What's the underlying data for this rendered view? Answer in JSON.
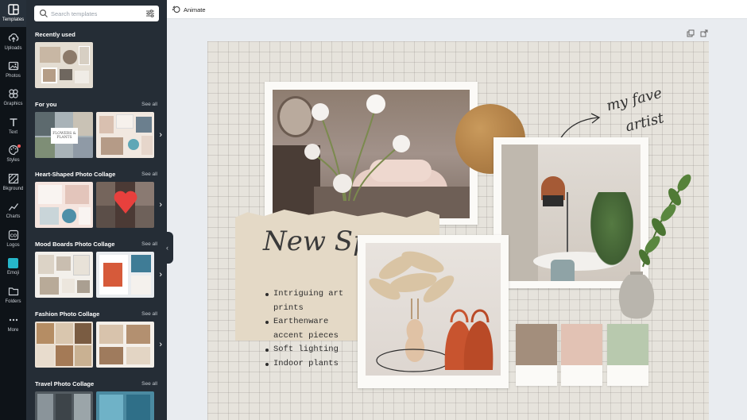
{
  "rail": {
    "items": [
      {
        "label": "Templates",
        "icon": "templates-icon"
      },
      {
        "label": "Uploads",
        "icon": "upload-icon"
      },
      {
        "label": "Photos",
        "icon": "photo-icon"
      },
      {
        "label": "Graphics",
        "icon": "graphics-icon"
      },
      {
        "label": "Text",
        "icon": "text-icon"
      },
      {
        "label": "Styles",
        "icon": "styles-icon"
      },
      {
        "label": "Bkground",
        "icon": "background-icon"
      },
      {
        "label": "Charts",
        "icon": "chart-icon"
      },
      {
        "label": "Logos",
        "icon": "logo-icon"
      },
      {
        "label": "Emoji",
        "icon": "emoji-icon"
      },
      {
        "label": "Folders",
        "icon": "folder-icon"
      },
      {
        "label": "More",
        "icon": "more-icon"
      }
    ]
  },
  "panel": {
    "search_placeholder": "Search templates",
    "recently_used": "Recently used",
    "see_all": "See all",
    "sections": [
      {
        "title": "For you"
      },
      {
        "title": "Heart-Shaped Photo Collage"
      },
      {
        "title": "Mood Boards Photo Collage"
      },
      {
        "title": "Fashion Photo Collage"
      },
      {
        "title": "Travel Photo Collage"
      }
    ],
    "thumb_text": {
      "flowers": "FLOWERS & PLANTS"
    }
  },
  "topbar": {
    "animate_label": "Animate"
  },
  "canvas": {
    "title": "New Spaces",
    "handwritten": [
      "my fave",
      "artist"
    ],
    "bullets": [
      "Intriguing art prints",
      "Earthenware accent pieces",
      "Soft lighting",
      "Indoor plants"
    ],
    "swatches": [
      "#a38e7c",
      "#e2c2b4",
      "#b8c9ae"
    ]
  },
  "colors": {
    "rail_bg": "#0e1318",
    "panel_bg": "#252d36",
    "canvas_bg": "#e6e3dc",
    "accent": "#26b6c9"
  }
}
